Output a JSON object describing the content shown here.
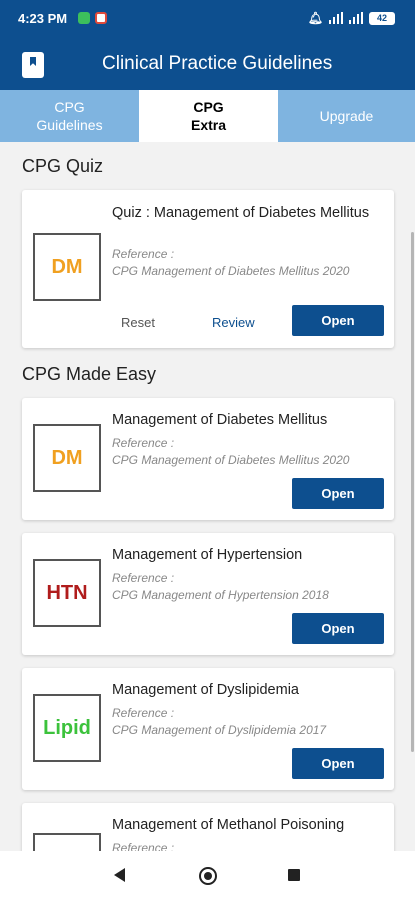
{
  "status_bar": {
    "time": "4:23 PM",
    "battery": "42"
  },
  "app_bar": {
    "title": "Clinical Practice Guidelines"
  },
  "tabs": [
    {
      "line1": "CPG",
      "line2": "Guidelines"
    },
    {
      "line1": "CPG",
      "line2": "Extra"
    },
    {
      "line1": "Upgrade",
      "line2": ""
    }
  ],
  "sections": {
    "quiz": "CPG Quiz",
    "easy": "CPG Made Easy"
  },
  "quiz_card": {
    "thumb": "DM",
    "title": "Quiz : Management of Diabetes Mellitus",
    "ref_label": "Reference :",
    "ref_value": "CPG Management of Diabetes Mellitus 2020",
    "reset": "Reset",
    "review": "Review",
    "open": "Open"
  },
  "easy_cards": [
    {
      "thumb": "DM",
      "title": "Management of Diabetes Mellitus",
      "ref_label": "Reference :",
      "ref_value": "CPG Management of Diabetes Mellitus 2020",
      "open": "Open"
    },
    {
      "thumb": "HTN",
      "title": "Management of Hypertension",
      "ref_label": "Reference :",
      "ref_value": "CPG Management of Hypertension 2018",
      "open": "Open"
    },
    {
      "thumb": "Lipid",
      "title": "Management of Dyslipidemia",
      "ref_label": "Reference :",
      "ref_value": "CPG Management of Dyslipidemia 2017",
      "open": "Open"
    },
    {
      "thumb": "",
      "title": "Management of Methanol Poisoning",
      "ref_label": "Reference :",
      "ref_value": "",
      "open": ""
    }
  ],
  "colors": {
    "primary": "#0d4f8f",
    "tab_inactive": "#7fb4e0",
    "dm": "#f0a020",
    "htn": "#b01c1c",
    "lipid": "#3cc23c"
  },
  "icons": [
    "book-icon",
    "mute-icon",
    "signal-icon",
    "battery-icon",
    "back-icon",
    "home-icon",
    "recent-apps-icon"
  ]
}
